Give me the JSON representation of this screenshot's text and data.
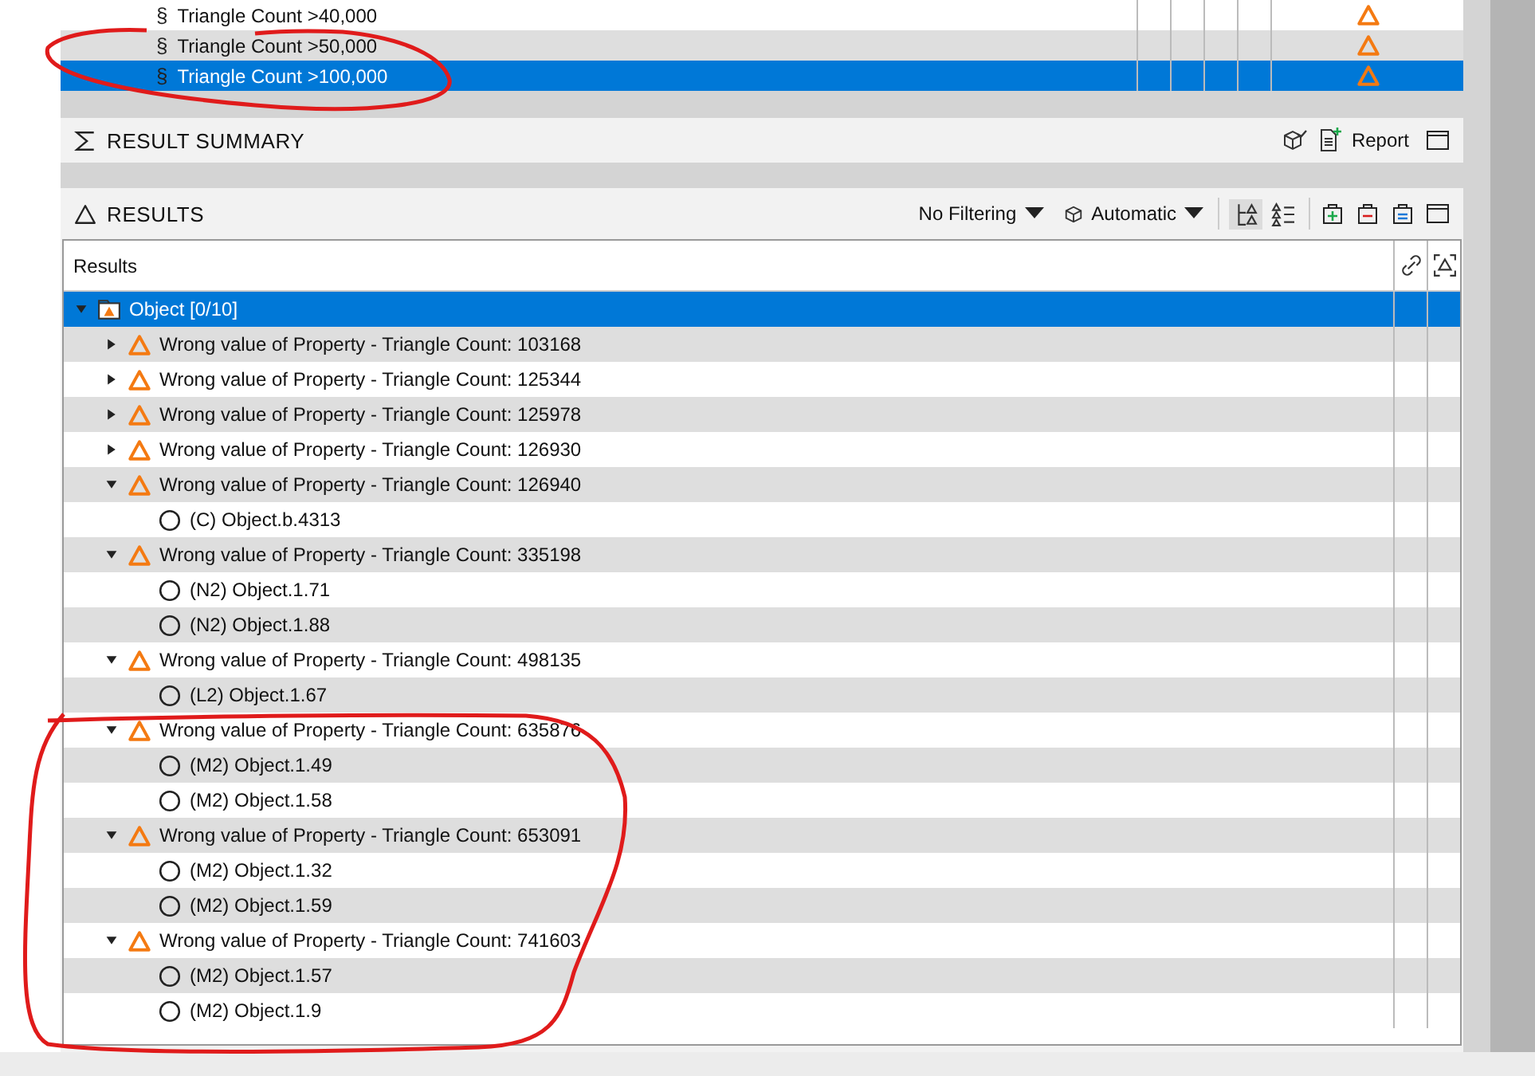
{
  "rules": [
    {
      "icon": "§",
      "label": "Triangle Count >40,000",
      "selected": false
    },
    {
      "icon": "§",
      "label": "Triangle Count >50,000",
      "selected": false
    },
    {
      "icon": "§",
      "label": "Triangle Count >100,000",
      "selected": true
    }
  ],
  "result_summary": {
    "title": "RESULT SUMMARY",
    "report_button": "Report"
  },
  "results": {
    "title": "RESULTS",
    "filter": "No Filtering",
    "mode": "Automatic",
    "views": [
      {
        "kind": "tree",
        "selected": true
      },
      {
        "kind": "list",
        "selected": false
      }
    ],
    "column_header": "Results",
    "tree": [
      {
        "kind": "group",
        "label": "Object [0/10]",
        "selected": true,
        "expanded": true,
        "children": [
          {
            "kind": "issue",
            "label": "Wrong value of Property - Triangle Count: 103168",
            "selected": false,
            "expanded": false
          },
          {
            "kind": "issue",
            "label": "Wrong value of Property - Triangle Count: 125344",
            "selected": false,
            "expanded": false
          },
          {
            "kind": "issue",
            "label": "Wrong value of Property - Triangle Count: 125978",
            "selected": false,
            "expanded": false
          },
          {
            "kind": "issue",
            "label": "Wrong value of Property - Triangle Count: 126930",
            "selected": false,
            "expanded": false
          },
          {
            "kind": "issue",
            "label": "Wrong value of Property - Triangle Count: 126940",
            "selected": false,
            "expanded": true,
            "children": [
              {
                "kind": "object",
                "label": "(C) Object.b.4313",
                "selected": false
              }
            ]
          },
          {
            "kind": "issue",
            "label": "Wrong value of Property - Triangle Count: 335198",
            "selected": false,
            "expanded": true,
            "children": [
              {
                "kind": "object",
                "label": "(N2) Object.1.71",
                "selected": false
              },
              {
                "kind": "object",
                "label": "(N2) Object.1.88",
                "selected": false
              }
            ]
          },
          {
            "kind": "issue",
            "label": "Wrong value of Property - Triangle Count: 498135",
            "selected": false,
            "expanded": true,
            "children": [
              {
                "kind": "object",
                "label": "(L2) Object.1.67",
                "selected": false
              }
            ]
          },
          {
            "kind": "issue",
            "label": "Wrong value of Property - Triangle Count: 635876",
            "selected": false,
            "expanded": true,
            "children": [
              {
                "kind": "object",
                "label": "(M2) Object.1.49",
                "selected": false
              },
              {
                "kind": "object",
                "label": "(M2) Object.1.58",
                "selected": false
              }
            ]
          },
          {
            "kind": "issue",
            "label": "Wrong value of Property - Triangle Count: 653091",
            "selected": false,
            "expanded": true,
            "children": [
              {
                "kind": "object",
                "label": "(M2) Object.1.32",
                "selected": false
              },
              {
                "kind": "object",
                "label": "(M2) Object.1.59",
                "selected": false
              }
            ]
          },
          {
            "kind": "issue",
            "label": "Wrong value of Property - Triangle Count: 741603",
            "selected": false,
            "expanded": true,
            "children": [
              {
                "kind": "object",
                "label": "(M2) Object.1.57",
                "selected": false
              },
              {
                "kind": "object",
                "label": "(M2) Object.1.9",
                "selected": false
              }
            ]
          }
        ]
      }
    ]
  }
}
